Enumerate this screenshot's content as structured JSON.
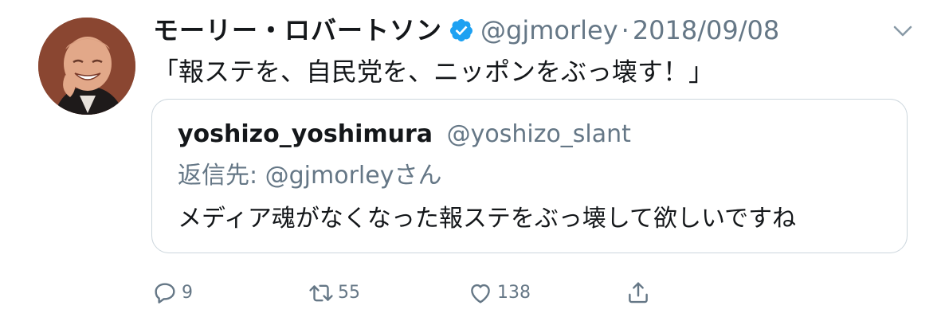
{
  "tweet": {
    "display_name": "モーリー・ロバートソン",
    "handle": "@gjmorley",
    "separator": "·",
    "date": "2018/09/08",
    "text": "「報ステを、自民党を、ニッポンをぶっ壊す！」"
  },
  "quoted_tweet": {
    "display_name": "yoshizo_yoshimura",
    "handle": "@yoshizo_slant",
    "reply_to": "返信先: @gjmorleyさん",
    "text": "メディア魂がなくなった報ステをぶっ壊して欲しいですね"
  },
  "actions": {
    "reply_count": "9",
    "retweet_count": "55",
    "like_count": "138"
  },
  "icons": [
    "verified-badge-icon",
    "chevron-down-icon",
    "reply-icon",
    "retweet-icon",
    "like-icon",
    "share-icon"
  ],
  "colors": {
    "verified": "#1da1f2",
    "secondary_text": "#657786",
    "border": "#ccd6dd"
  }
}
